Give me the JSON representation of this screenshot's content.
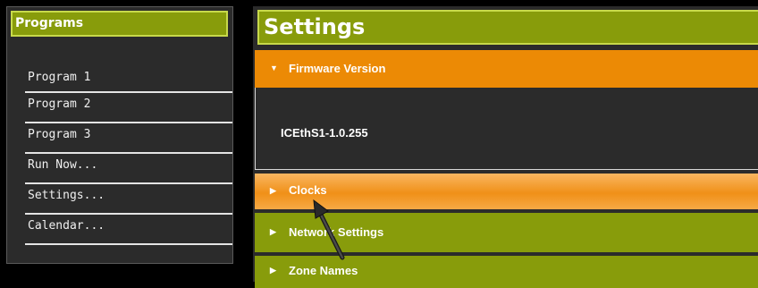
{
  "programs": {
    "title": "Programs",
    "items": [
      {
        "label": "Program 1"
      },
      {
        "label": "Program 2"
      },
      {
        "label": "Program 3"
      },
      {
        "label": "Run Now..."
      },
      {
        "label": "Settings..."
      },
      {
        "label": "Calendar..."
      }
    ]
  },
  "settings": {
    "title": "Settings",
    "sections": [
      {
        "label": "Firmware Version",
        "expanded": true,
        "value": "ICEthS1-1.0.255"
      },
      {
        "label": "Clocks",
        "expanded": false
      },
      {
        "label": "Network Settings",
        "expanded": false
      },
      {
        "label": "Zone Names",
        "expanded": false
      }
    ]
  },
  "icons": {
    "expanded_arrow": "▼",
    "collapsed_arrow": "▶",
    "cursor": "mouse-pointer-icon"
  },
  "colors": {
    "green_header": "#889c0b",
    "green_border": "#c7d94a",
    "orange_active": "#ec8a05",
    "panel_bg": "#2b2b2b"
  }
}
